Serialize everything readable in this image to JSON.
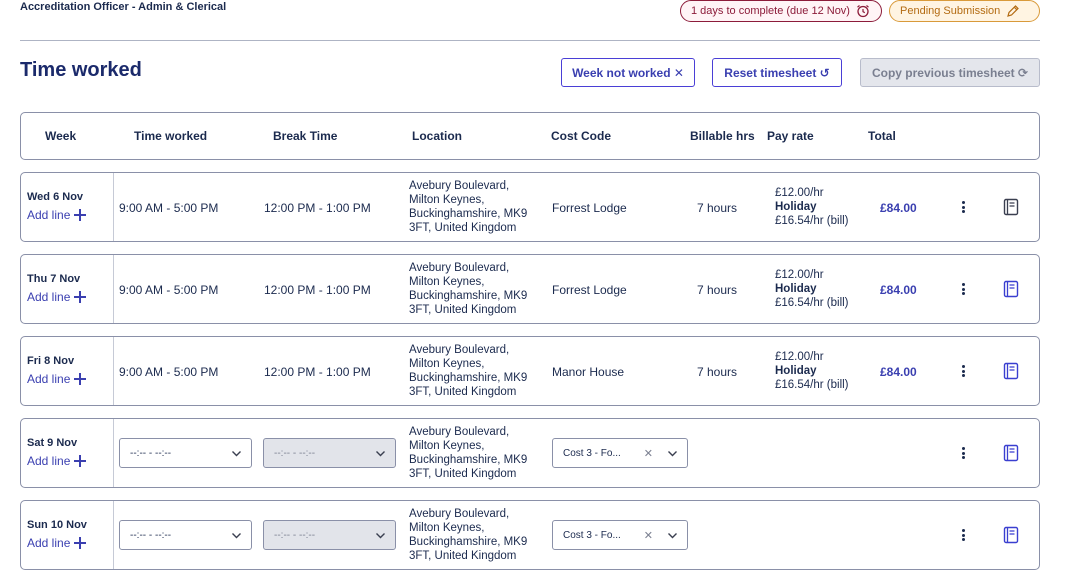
{
  "header": {
    "job_title": "Accreditation Officer - Admin & Clerical",
    "days_pill": "1 days to complete (due 12 Nov)",
    "status_pill": "Pending Submission",
    "days_icon": "alarm-clock-icon",
    "status_icon": "pencil-icon"
  },
  "section": {
    "title": "Time worked",
    "buttons": {
      "week_not_worked": "Week not worked ✕",
      "reset": "Reset timesheet ↺",
      "copy": "Copy previous timesheet ⟳"
    }
  },
  "columns": [
    "Week",
    "Time worked",
    "Break Time",
    "Location",
    "Cost Code",
    "Billable hrs",
    "Pay rate",
    "Total"
  ],
  "rows": [
    {
      "day": "Wed 6 Nov",
      "add_line": "Add line",
      "time": "9:00 AM - 5:00 PM",
      "break": "12:00 PM - 1:00 PM",
      "location": [
        "Avebury Boulevard,",
        "Milton Keynes,",
        "Buckinghamshire, MK9",
        "3FT, United Kingdom"
      ],
      "cost": "Forrest Lodge",
      "hours": "7 hours",
      "pay": [
        "£12.00/hr",
        "Holiday",
        "£16.54/hr (bill)"
      ],
      "total": "£84.00"
    },
    {
      "day": "Thu 7 Nov",
      "add_line": "Add line",
      "time": "9:00 AM - 5:00 PM",
      "break": "12:00 PM - 1:00 PM",
      "location": [
        "Avebury Boulevard,",
        "Milton Keynes,",
        "Buckinghamshire, MK9",
        "3FT, United Kingdom"
      ],
      "cost": "Forrest Lodge",
      "hours": "7 hours",
      "pay": [
        "£12.00/hr",
        "Holiday",
        "£16.54/hr (bill)"
      ],
      "total": "£84.00"
    },
    {
      "day": "Fri 8 Nov",
      "add_line": "Add line",
      "time": "9:00 AM - 5:00 PM",
      "break": "12:00 PM - 1:00 PM",
      "location": [
        "Avebury Boulevard,",
        "Milton Keynes,",
        "Buckinghamshire, MK9",
        "3FT, United Kingdom"
      ],
      "cost": "Manor House",
      "hours": "7 hours",
      "pay": [
        "£12.00/hr",
        "Holiday",
        "£16.54/hr (bill)"
      ],
      "total": "£84.00"
    },
    {
      "day": "Sat 9 Nov",
      "add_line": "Add line",
      "time_select": "--:-- - --:--",
      "break_select": "--:-- - --:--",
      "location": [
        "Avebury Boulevard,",
        "Milton Keynes,",
        "Buckinghamshire, MK9",
        "3FT, United Kingdom"
      ],
      "cost_select": "Cost 3 - Fo..."
    },
    {
      "day": "Sun 10 Nov",
      "add_line": "Add line",
      "time_select": "--:-- - --:--",
      "break_select": "--:-- - --:--",
      "location": [
        "Avebury Boulevard,",
        "Milton Keynes,",
        "Buckinghamshire, MK9",
        "3FT, United Kingdom"
      ],
      "cost_select": "Cost 3 - Fo..."
    }
  ]
}
